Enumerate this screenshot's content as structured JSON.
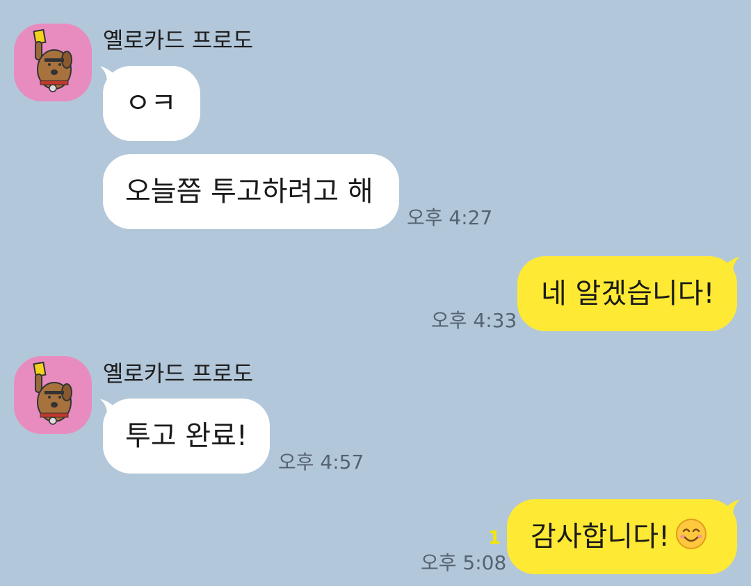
{
  "chat": {
    "sender_name": "옐로카드 프로도",
    "avatar_icon": "frodo-yellow-card-avatar-icon",
    "colors": {
      "background": "#b2c7da",
      "incoming_bubble": "#ffffff",
      "outgoing_bubble": "#fee934",
      "avatar_bg": "#e88cc0",
      "unread": "#f7e600"
    },
    "messages": [
      {
        "direction": "incoming",
        "text": "ㅇㅋ"
      },
      {
        "direction": "incoming",
        "text": "오늘쯤 투고하려고 해",
        "time": "오후 4:27"
      },
      {
        "direction": "outgoing",
        "text": "네 알겠습니다!",
        "time": "오후 4:33"
      },
      {
        "direction": "incoming",
        "text": "투고 완료!",
        "time": "오후 4:57"
      },
      {
        "direction": "outgoing",
        "text": "감사합니다!",
        "emoji": "smiling-face-icon",
        "time": "오후 5:08",
        "unread": "1"
      }
    ]
  }
}
